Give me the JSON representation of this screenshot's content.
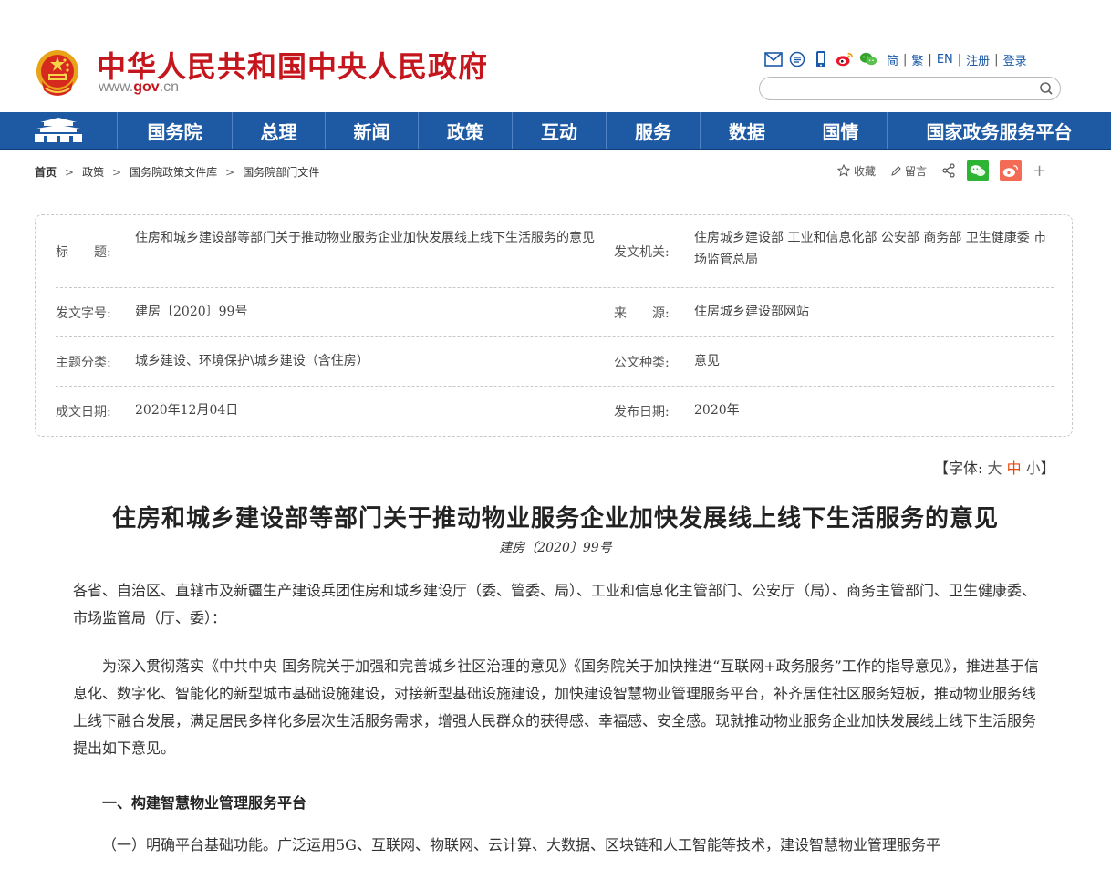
{
  "header": {
    "title": "中华人民共和国中央人民政府",
    "url_prefix": "www.",
    "url_bold": "gov",
    "url_suffix": ".cn",
    "brand_color": "#c4161c",
    "tool_icons": [
      "mail-icon",
      "rss-icon",
      "mobile-icon",
      "weibo-icon",
      "wechat-icon"
    ],
    "lang_links": [
      "简",
      "繁",
      "EN",
      "注册",
      "登录"
    ],
    "search_placeholder": ""
  },
  "nav": {
    "color": "#1d5aa3",
    "items": [
      "国务院",
      "总理",
      "新闻",
      "政策",
      "互动",
      "服务",
      "数据",
      "国情",
      "国家政务服务平台"
    ]
  },
  "breadcrumb": {
    "home": "首页",
    "items": [
      "政策",
      "国务院政策文件库",
      "国务院部门文件"
    ]
  },
  "actions": {
    "favorite": "收藏",
    "comment": "留言",
    "more": "+"
  },
  "info": {
    "title_label": "标　　题:",
    "title_value": "住房和城乡建设部等部门关于推动物业服务企业加快发展线上线下生活服务的意见",
    "issuer_label": "发文机关:",
    "issuer_value": "住房城乡建设部 工业和信息化部 公安部 商务部 卫生健康委 市场监管总局",
    "docno_label": "发文字号:",
    "docno_value": "建房〔2020〕99号",
    "source_label": "来　　源:",
    "source_value": "住房城乡建设部网站",
    "topic_label": "主题分类:",
    "topic_value": "城乡建设、环境保护\\城乡建设（含住房）",
    "type_label": "公文种类:",
    "type_value": "意见",
    "date_label": "成文日期:",
    "date_value": "2020年12月04日",
    "pubdate_label": "发布日期:",
    "pubdate_value": "2020年"
  },
  "fontsize": {
    "open": "【字体:",
    "large": "大",
    "medium": "中",
    "small": "小",
    "close": "】"
  },
  "article": {
    "title": "住房和城乡建设部等部门关于推动物业服务企业加快发展线上线下生活服务的意见",
    "doc_number": "建房〔2020〕99号",
    "salutation": "各省、自治区、直辖市及新疆生产建设兵团住房和城乡建设厅（委、管委、局）、工业和信息化主管部门、公安厅（局）、商务主管部门、卫生健康委、市场监管局（厅、委）：",
    "intro": "为深入贯彻落实《中共中央 国务院关于加强和完善城乡社区治理的意见》《国务院关于加快推进“互联网+政务服务”工作的指导意见》，推进基于信息化、数字化、智能化的新型城市基础设施建设，对接新型基础设施建设，加快建设智慧物业管理服务平台，补齐居住社区服务短板，推动物业服务线上线下融合发展，满足居民多样化多层次生活服务需求，增强人民群众的获得感、幸福感、安全感。现就推动物业服务企业加快发展线上线下生活服务提出如下意见。",
    "section1": "一、构建智慧物业管理服务平台",
    "para1": "（一）明确平台基础功能。广泛运用5G、互联网、物联网、云计算、大数据、区块链和人工智能等技术，建设智慧物业管理服务平"
  }
}
